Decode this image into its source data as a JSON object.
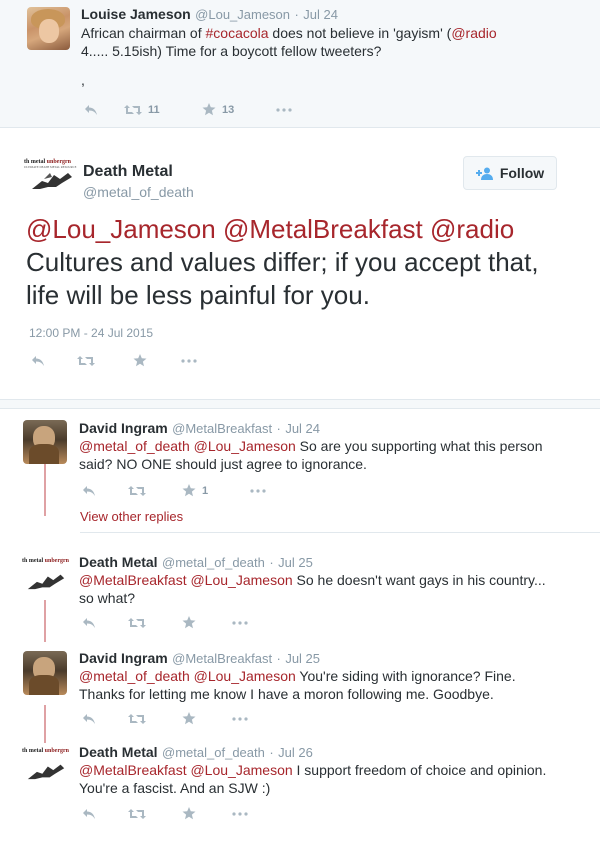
{
  "top_tweet": {
    "name": "Louise Jameson",
    "handle": "@Lou_Jameson",
    "time": "Jul 24",
    "text_parts": [
      "African chairman of ",
      "#cocacola",
      " does not believe in 'gayism' (",
      "@radio",
      " 4..... 5.15ish)  Time for a boycott fellow tweeters?"
    ],
    "extra_line": ",",
    "retweets": "11",
    "favorites": "13"
  },
  "main_tweet": {
    "name": "Death Metal",
    "handle": "@metal_of_death",
    "follow_label": "Follow",
    "mentions": "@Lou_Jameson @MetalBreakfast @radio",
    "text": "Cultures and values differ; if you accept that, life will be less painful for you.",
    "timestamp": "12:00 PM - 24 Jul 2015",
    "logo_text_1": "th metal",
    "logo_text_2": "unbergrn",
    "logo_subtitle": "ULTIMATE DEATH METAL RESOURCE"
  },
  "replies": [
    {
      "name": "David Ingram",
      "handle": "@MetalBreakfast",
      "time": "Jul 24",
      "mentions": "@metal_of_death @Lou_Jameson",
      "text": " So are you supporting what this person said? NO ONE should just agree to ignorance.",
      "favorites": "1",
      "view_other": "View other replies"
    },
    {
      "name": "Death Metal",
      "handle": "@metal_of_death",
      "time": "Jul 25",
      "mentions": "@MetalBreakfast @Lou_Jameson",
      "text": " So he doesn't want gays in his country... so what?"
    },
    {
      "name": "David Ingram",
      "handle": "@MetalBreakfast",
      "time": "Jul 25",
      "mentions": "@metal_of_death @Lou_Jameson",
      "text": " You're siding with ignorance? Fine. Thanks for letting me know I have a moron following me. Goodbye."
    },
    {
      "name": "Death Metal",
      "handle": "@metal_of_death",
      "time": "Jul 26",
      "mentions": "@MetalBreakfast @Lou_Jameson",
      "text": " I support freedom of choice and opinion. You're a fascist. And an SJW :)"
    }
  ],
  "separator": "·",
  "colors": {
    "link": "#a7262c",
    "meta": "#8899a6",
    "icon": "#aab8c2",
    "follow_blue": "#55acee"
  }
}
